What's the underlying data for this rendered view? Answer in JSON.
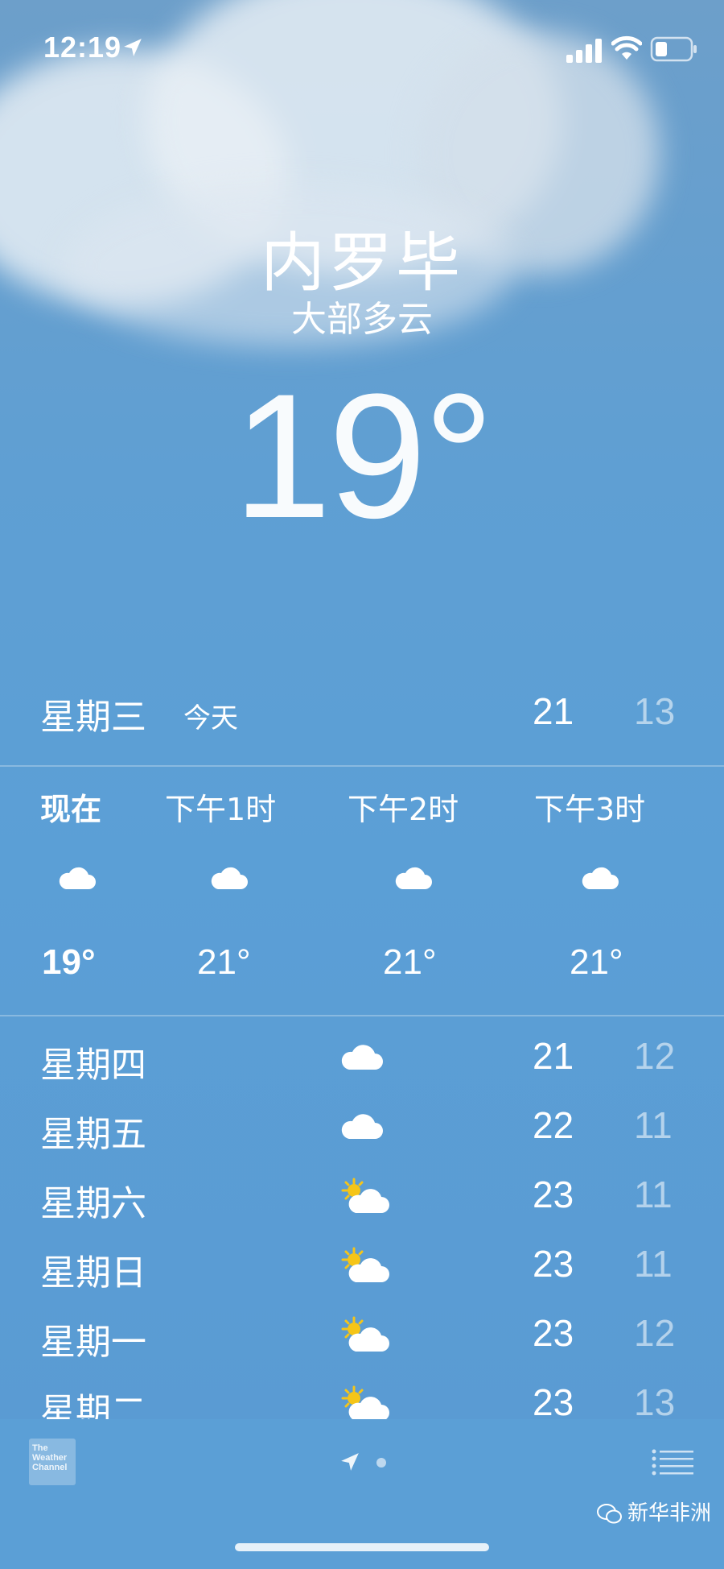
{
  "status_bar": {
    "time": "12:19"
  },
  "header": {
    "city": "内罗毕",
    "condition": "大部多云",
    "temperature": "19°"
  },
  "today": {
    "day": "星期三",
    "label": "今天",
    "high": "21",
    "low": "13"
  },
  "hourly": [
    {
      "label": "现在",
      "icon": "cloud-icon",
      "temp": "19°"
    },
    {
      "label": "下午1时",
      "icon": "cloud-icon",
      "temp": "21°"
    },
    {
      "label": "下午2时",
      "icon": "cloud-icon",
      "temp": "21°"
    },
    {
      "label": "下午3时",
      "icon": "cloud-icon",
      "temp": "21°"
    }
  ],
  "daily": [
    {
      "day": "星期四",
      "icon": "cloud-icon",
      "high": "21",
      "low": "12"
    },
    {
      "day": "星期五",
      "icon": "cloud-icon",
      "high": "22",
      "low": "11"
    },
    {
      "day": "星期六",
      "icon": "partly-sunny-icon",
      "high": "23",
      "low": "11"
    },
    {
      "day": "星期日",
      "icon": "partly-sunny-icon",
      "high": "23",
      "low": "11"
    },
    {
      "day": "星期一",
      "icon": "partly-sunny-icon",
      "high": "23",
      "low": "12"
    },
    {
      "day": "星期二",
      "icon": "partly-sunny-icon",
      "high": "23",
      "low": "13"
    }
  ],
  "footer": {
    "provider_logo": "The Weather Channel",
    "watermark": "新华非洲"
  },
  "colors": {
    "sky": "#5b9fd6",
    "sun": "#f5c518",
    "low_temp": "rgba(255,255,255,0.55)"
  }
}
